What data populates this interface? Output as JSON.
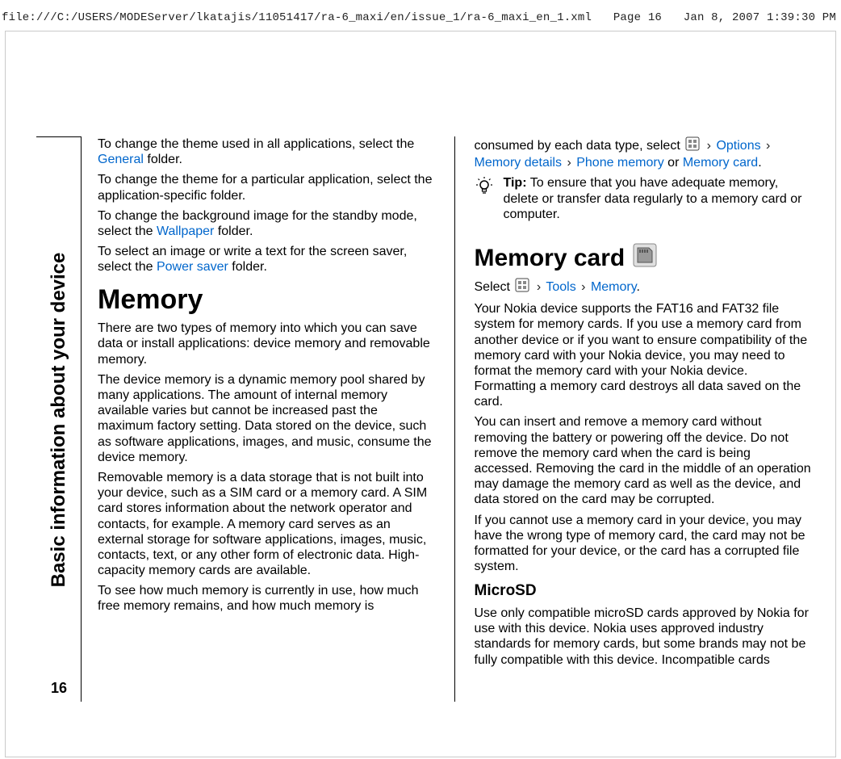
{
  "header": {
    "path": "file:///C:/USERS/MODEServer/lkatajis/11051417/ra-6_maxi/en/issue_1/ra-6_maxi_en_1.xml",
    "page": "Page 16",
    "timestamp": "Jan 8, 2007 1:39:30 PM"
  },
  "margin": {
    "title": "Basic information about your device",
    "page_number": "16"
  },
  "col1": {
    "p1a": "To change the theme used in all applications, select the ",
    "p1b": "General",
    "p1c": " folder.",
    "p2": "To change the theme for a particular application, select the application-specific folder.",
    "p3a": "To change the background image for the standby mode, select the ",
    "p3b": "Wallpaper",
    "p3c": " folder.",
    "p4a": "To select an image or write a text for the screen saver, select the ",
    "p4b": "Power saver",
    "p4c": " folder.",
    "h_memory": "Memory",
    "p5": "There are two types of memory into which you can save data or install applications: device memory and removable memory.",
    "p6": "The device memory is a dynamic memory pool shared by many applications. The amount of internal memory available varies but cannot be increased past the maximum factory setting. Data stored on the device, such as software applications, images, and music, consume the device memory.",
    "p7": "Removable memory is a data storage that is not built into your device, such as a SIM card or a memory card. A SIM card stores information about the network operator and contacts, for example. A memory card serves as an external storage for software applications, images, music, contacts, text, or any other form of electronic data. High-capacity memory cards are available.",
    "p8": "To see how much memory is currently in use, how much free memory remains, and how much memory is"
  },
  "col2": {
    "continued_a": "consumed by each data type, select ",
    "opt": "Options",
    "memdetails": "Memory details",
    "phonemem": "Phone memory",
    "or": " or ",
    "memcard_link": "Memory card",
    "dot": ".",
    "tip_label": "Tip:",
    "tip_text": " To ensure that you have adequate memory, delete or transfer data regularly to a memory card or computer.",
    "h_memcard": "Memory card",
    "sel": "Select ",
    "tools": "Tools",
    "memory": "Memory",
    "p1": "Your Nokia device supports the FAT16 and FAT32 file system for memory cards. If you use a memory card from another device or if you want to ensure compatibility of the memory card with your Nokia device, you may need to format the memory card with your Nokia device. Formatting a memory card destroys all data saved on the card.",
    "p2": "You can insert and remove a memory card without removing the battery or powering off the device. Do not remove the memory card when the card is being accessed. Removing the card in the middle of an operation may damage the memory card as well as the device, and data stored on the card may be corrupted.",
    "p3": "If you cannot use a memory card in your device, you may have the wrong type of memory card, the card may not be formatted for your device, or the card has a corrupted file system.",
    "h_microsd": "MicroSD",
    "p4": "Use only compatible microSD cards approved by Nokia for use with this device. Nokia uses approved industry standards for memory cards, but some brands may not be fully compatible with this device. Incompatible cards"
  },
  "glyphs": {
    "chev": "›"
  }
}
